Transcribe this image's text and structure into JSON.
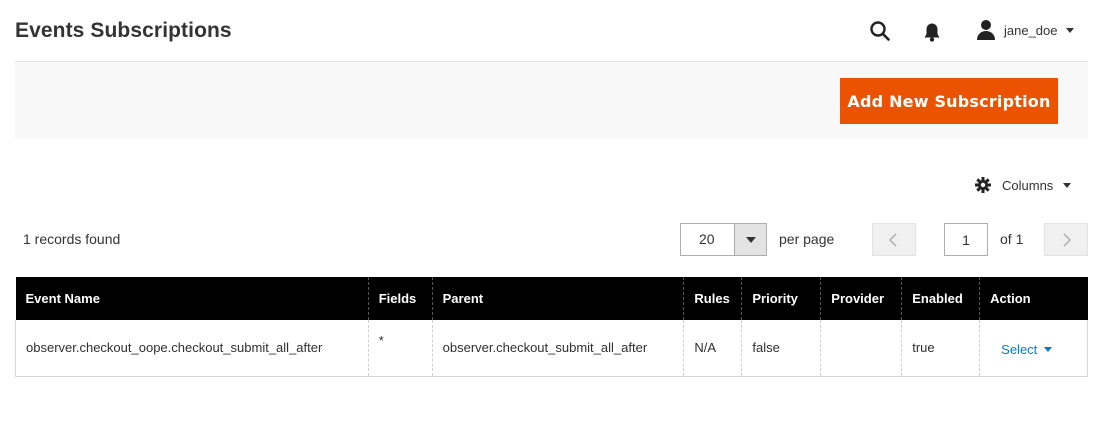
{
  "header": {
    "title": "Events Subscriptions",
    "icons": {
      "search": "search-icon",
      "notifications": "bell-icon",
      "user": "user-icon"
    },
    "user_name": "jane_doe"
  },
  "actions": {
    "add_label": "Add New Subscription",
    "accent_color": "#eb5202"
  },
  "toolbar": {
    "columns_label": "Columns",
    "records_found": "1 records found",
    "per_page_value": "20",
    "per_page_label": "per page",
    "current_page": "1",
    "of_pages": "of 1"
  },
  "grid": {
    "columns": [
      "Event Name",
      "Fields",
      "Parent",
      "Rules",
      "Priority",
      "Provider",
      "Enabled",
      "Action"
    ],
    "rows": [
      {
        "event_name": "observer.checkout_oope.checkout_submit_all_after",
        "fields": "*",
        "parent": "observer.checkout_submit_all_after",
        "rules": "N/A",
        "priority": "false",
        "provider": "",
        "enabled": "true",
        "action": "Select"
      }
    ]
  }
}
